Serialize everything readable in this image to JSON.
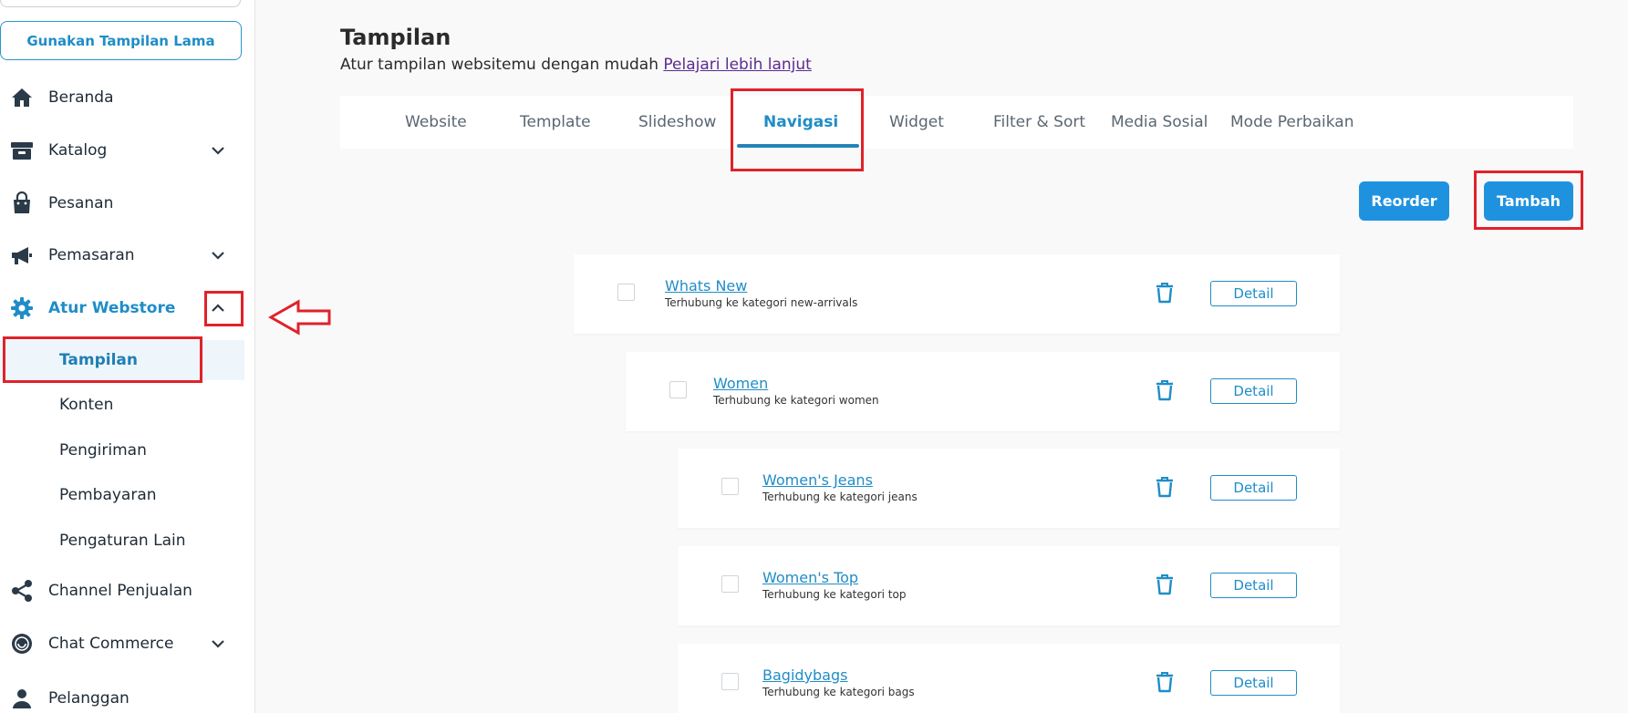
{
  "sidebar": {
    "old_view_label": "Gunakan Tampilan Lama",
    "items": [
      {
        "label": "Beranda",
        "icon": "home-icon"
      },
      {
        "label": "Katalog",
        "icon": "archive-icon"
      },
      {
        "label": "Pesanan",
        "icon": "shopping-bag-icon"
      },
      {
        "label": "Pemasaran",
        "icon": "megaphone-icon"
      },
      {
        "label": "Atur Webstore",
        "icon": "gear-icon"
      },
      {
        "label": "Channel Penjualan",
        "icon": "share-icon"
      },
      {
        "label": "Chat Commerce",
        "icon": "chat-icon"
      },
      {
        "label": "Pelanggan",
        "icon": "users-icon"
      }
    ],
    "submenu": [
      {
        "label": "Tampilan"
      },
      {
        "label": "Konten"
      },
      {
        "label": "Pengiriman"
      },
      {
        "label": "Pembayaran"
      },
      {
        "label": "Pengaturan Lain"
      }
    ]
  },
  "header": {
    "title": "Tampilan",
    "subtitle": "Atur tampilan websitemu dengan mudah",
    "learn_more": "Pelajari lebih lanjut"
  },
  "tabs": [
    {
      "label": "Website"
    },
    {
      "label": "Template"
    },
    {
      "label": "Slideshow"
    },
    {
      "label": "Navigasi"
    },
    {
      "label": "Widget"
    },
    {
      "label": "Filter & Sort"
    },
    {
      "label": "Media Sosial"
    },
    {
      "label": "Mode Perbaikan"
    }
  ],
  "active_tab": "Navigasi",
  "actions": {
    "reorder_label": "Reorder",
    "add_label": "Tambah"
  },
  "nav_items": [
    {
      "title": "Whats New",
      "subtitle": "Terhubung ke kategori new-arrivals",
      "detail_label": "Detail"
    },
    {
      "title": "Women",
      "subtitle": "Terhubung ke kategori women",
      "detail_label": "Detail"
    },
    {
      "title": "Women's Jeans",
      "subtitle": "Terhubung ke kategori jeans",
      "detail_label": "Detail"
    },
    {
      "title": "Women's Top",
      "subtitle": "Terhubung ke kategori top",
      "detail_label": "Detail"
    },
    {
      "title": "Bagidybags",
      "subtitle": "Terhubung ke kategori bags",
      "detail_label": "Detail"
    }
  ],
  "colors": {
    "accent": "#1f8dc7",
    "button": "#1f92df",
    "annotation": "#e0222a",
    "icon_dark": "#2b3a48"
  }
}
